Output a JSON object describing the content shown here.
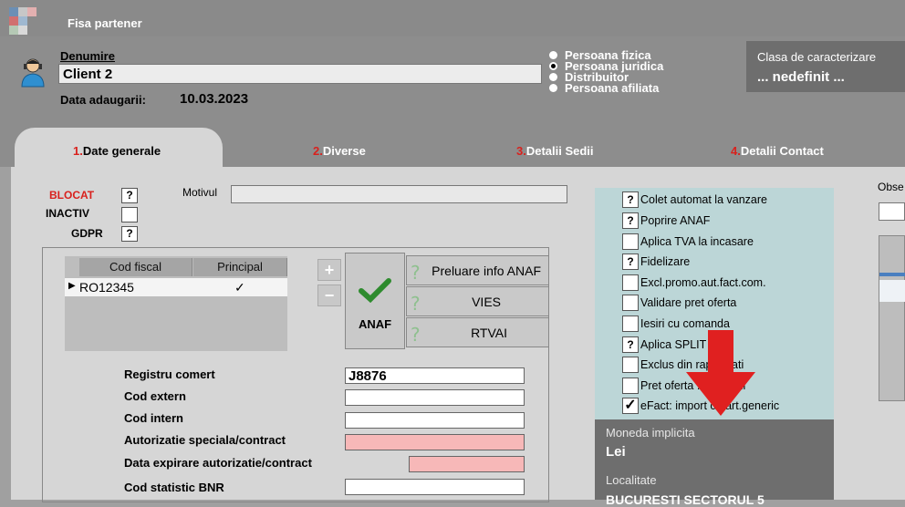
{
  "window": {
    "title": "Fisa partener"
  },
  "header": {
    "denumire_label": "Denumire",
    "denumire_value": "Client 2",
    "data_label": "Data adaugarii:",
    "data_value": "10.03.2023",
    "radio": [
      {
        "label": "Persoana fizica",
        "selected": false
      },
      {
        "label": "Persoana juridica",
        "selected": true
      },
      {
        "label": "Distribuitor",
        "selected": false
      },
      {
        "label": "Persoana afiliata",
        "selected": false
      }
    ],
    "clasa_label": "Clasa de caracterizare",
    "clasa_value": "... nedefinit ..."
  },
  "tabs": [
    {
      "num": "1.",
      "label": "Date generale",
      "active": true
    },
    {
      "num": "2.",
      "label": "Diverse",
      "active": false
    },
    {
      "num": "3.",
      "label": "Detalii Sedii",
      "active": false
    },
    {
      "num": "4.",
      "label": "Detalii Contact",
      "active": false
    }
  ],
  "general": {
    "blocat": "BLOCAT",
    "inactiv": "INACTIV",
    "gdpr": "GDPR",
    "q": "?",
    "motivul": "Motivul",
    "grid_headers": [
      "Cod fiscal",
      "Principal"
    ],
    "grid_row": {
      "cod": "RO12345",
      "principal": "✓"
    },
    "anaf": "ANAF",
    "preluare": "Preluare info ANAF",
    "vies": "VIES",
    "rtvai": "RTVAI",
    "fields": [
      {
        "label": "Registru comert",
        "value": "J8876"
      },
      {
        "label": "Cod extern",
        "value": ""
      },
      {
        "label": "Cod intern",
        "value": ""
      },
      {
        "label": "Autorizatie speciala/contract",
        "value": ""
      },
      {
        "label": "Data expirare autorizatie/contract",
        "value": ""
      },
      {
        "label": "Cod statistic BNR",
        "value": ""
      }
    ]
  },
  "options": [
    {
      "mark": "?",
      "label": "Colet automat la vanzare"
    },
    {
      "mark": "?",
      "label": "Poprire ANAF"
    },
    {
      "mark": "",
      "label": "Aplica TVA la incasare"
    },
    {
      "mark": "?",
      "label": "Fidelizare"
    },
    {
      "mark": "",
      "label": "Excl.promo.aut.fact.com."
    },
    {
      "mark": "",
      "label": "Validare pret oferta"
    },
    {
      "mark": "",
      "label": "Iesiri cu comanda"
    },
    {
      "mark": "?",
      "label": "Aplica SPLIT TVA"
    },
    {
      "mark": "",
      "label": "Exclus din rapoartati"
    },
    {
      "mark": "",
      "label": "Pret oferta ... variabil"
    },
    {
      "mark": "✓",
      "label": "eFact: import cu art.generic"
    }
  ],
  "moneda": {
    "label": "Moneda implicita",
    "value": "Lei"
  },
  "localitate": {
    "label": "Localitate",
    "value": "BUCURESTI SECTORUL 5"
  },
  "obse": {
    "label": "Obse"
  },
  "colors": {
    "accent_red": "#d9211d",
    "panel_teal": "#bcd6d7",
    "arrow": "#e02020"
  }
}
